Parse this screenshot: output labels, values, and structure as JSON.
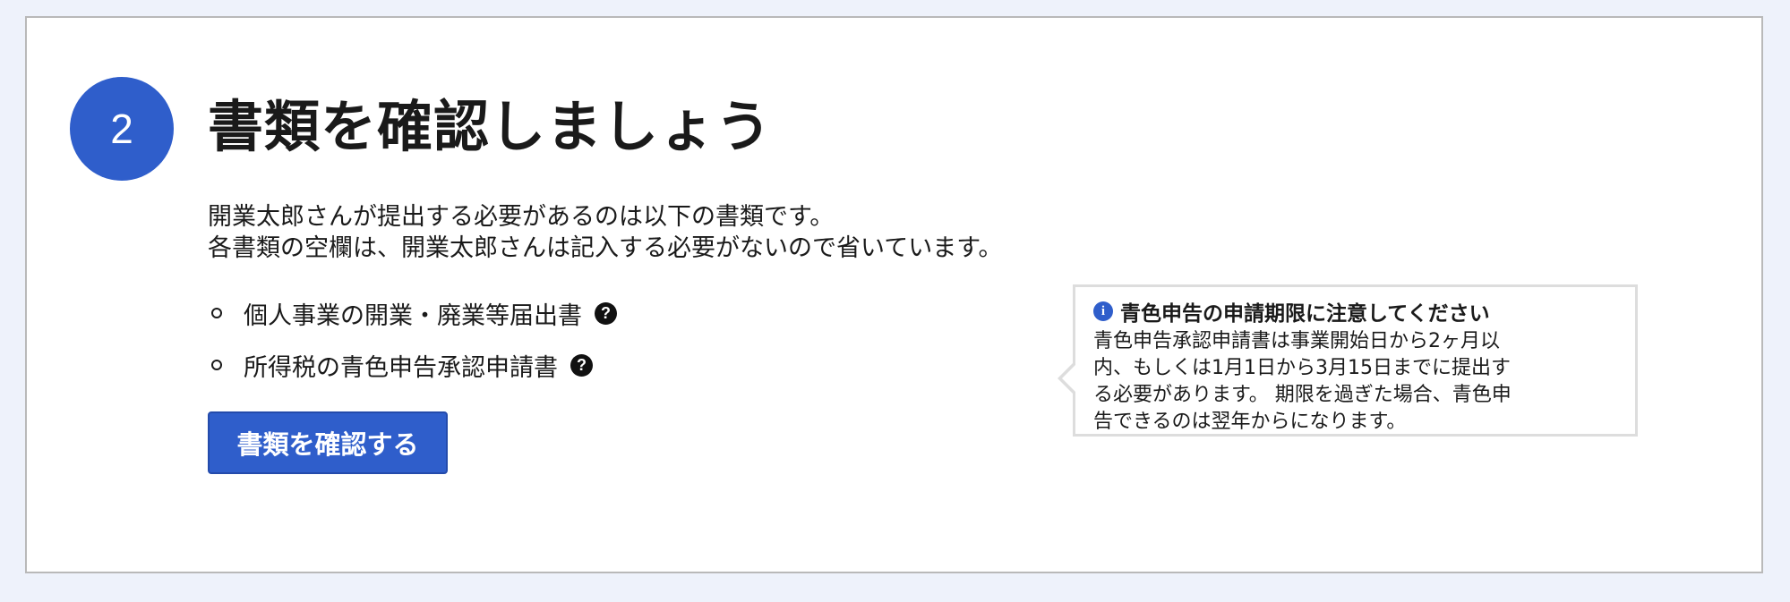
{
  "step": {
    "number": "2",
    "title": "書類を確認しましょう"
  },
  "description": {
    "line1": "開業太郎さんが提出する必要があるのは以下の書類です。",
    "line2": "各書類の空欄は、開業太郎さんは記入する必要がないので省いています。"
  },
  "documents": [
    {
      "label": "個人事業の開業・廃業等届出書",
      "help_icon": "question-circle-icon"
    },
    {
      "label": "所得税の青色申告承認申請書",
      "help_icon": "question-circle-icon"
    }
  ],
  "confirm_button": {
    "label": "書類を確認する"
  },
  "notice": {
    "icon": "info-circle-icon",
    "title": "青色申告の申請期限に注意してください",
    "body_lines": [
      "青色申告承認申請書は事業開始日から2ヶ月以",
      "内、もしくは1月1日から3月15日までに提出す",
      "る必要があります。 期限を過ぎた場合、青色申",
      "告できるのは翌年からになります。"
    ]
  },
  "colors": {
    "background": "#eef2fb",
    "accent": "#2f5ecb",
    "card_border": "#b9b9b9",
    "notice_border": "#dddddd"
  }
}
